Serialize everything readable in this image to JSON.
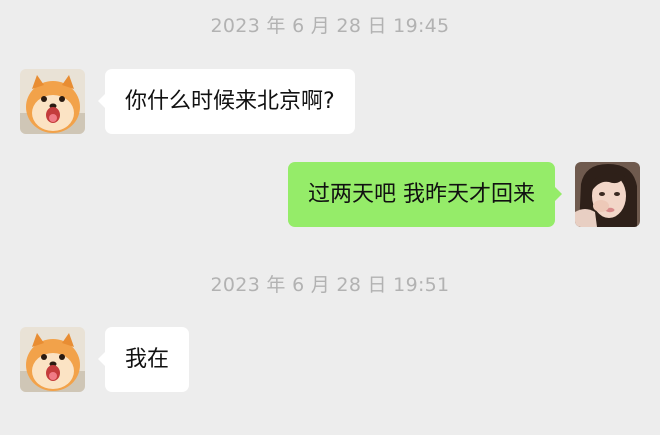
{
  "chat": {
    "timestamps": [
      "2023 年 6 月 28 日 19:45",
      "2023 年 6 月 28 日 19:51"
    ],
    "messages": [
      {
        "sender": "friend",
        "text": "你什么时候来北京啊?",
        "avatar": "pomeranian-dog"
      },
      {
        "sender": "self",
        "text": "过两天吧 我昨天才回来",
        "avatar": "woman-selfie"
      },
      {
        "sender": "friend",
        "text": "我在",
        "avatar": "pomeranian-dog"
      }
    ]
  },
  "colors": {
    "background": "#ededed",
    "incoming_bubble": "#ffffff",
    "outgoing_bubble": "#95ec69",
    "timestamp_text": "#b2b2b2"
  }
}
